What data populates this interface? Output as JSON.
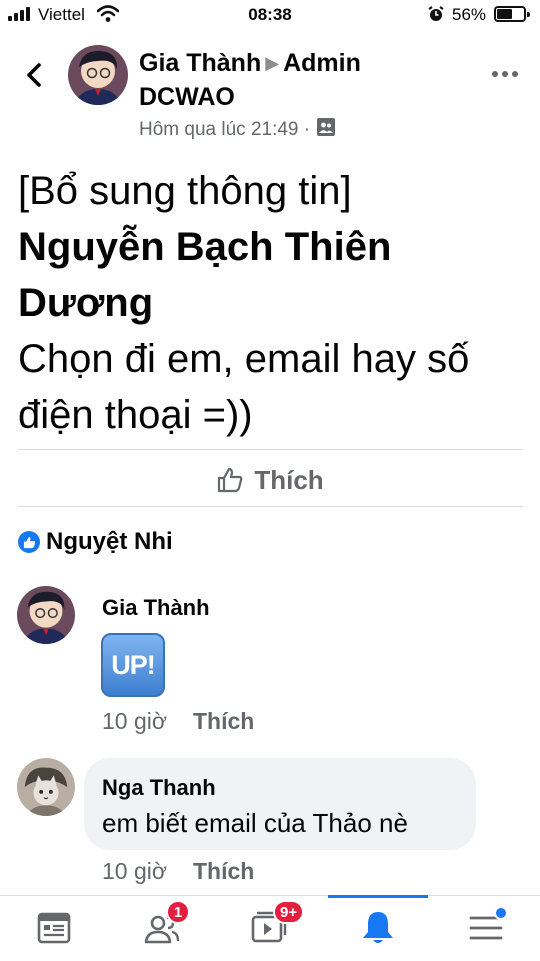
{
  "status_bar": {
    "carrier": "Viettel",
    "time": "08:38",
    "battery_percent": "56%",
    "battery_level": 0.56
  },
  "post": {
    "author": "Gia Thành",
    "group": "Admin DCWAO",
    "timestamp": "Hôm qua lúc 21:49 ·",
    "privacy_icon": "group-members-icon",
    "lines": {
      "line1": "[Bổ sung thông tin]",
      "line2": "Nguyễn Bạch Thiên",
      "line3": "Dương",
      "line4": "Chọn đi em, email hay số",
      "line5": "điện thoại =))"
    },
    "like_label": "Thích",
    "reacted_by": "Nguyệt Nhi"
  },
  "comments": [
    {
      "author": "Gia Thành",
      "sticker_text": "UP!",
      "time": "10 giờ",
      "like_label": "Thích"
    },
    {
      "author": "Nga Thanh",
      "text": "em biết email của Thảo nè",
      "time": "10 giờ",
      "like_label": "Thích"
    }
  ],
  "bottom_nav": {
    "friends_badge": "1",
    "watch_badge": "9+",
    "active_tab": "notifications"
  },
  "colors": {
    "accent": "#1877f2",
    "badge": "#e41e3f",
    "secondary_text": "#65676b"
  }
}
